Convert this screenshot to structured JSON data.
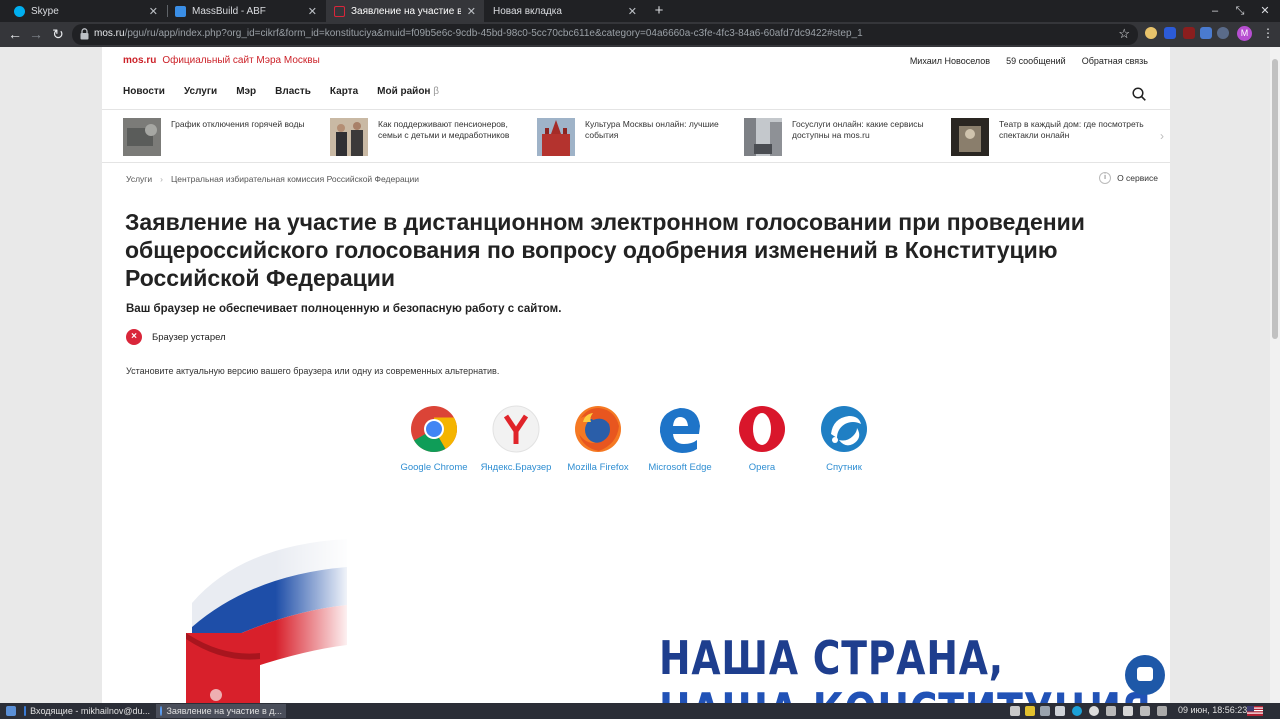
{
  "browser": {
    "tabs": [
      {
        "title": "Skype",
        "color": "#00aff0"
      },
      {
        "title": "MassBuild - ABF",
        "color": "#3a8ee6"
      },
      {
        "title": "Заявление на участие в дист",
        "color": "#d9263a"
      },
      {
        "title": "Новая вкладка",
        "color": ""
      }
    ],
    "url_domain": "mos.ru",
    "url_path": "/pgu/ru/app/index.php?org_id=cikrf&form_id=konstituciya&muid=f09b5e6c-9cdb-45bd-98c0-5cc70cbc611e&category=04a6660a-c3fe-4fc3-84a6-60afd7dc9422#step_1",
    "profile_initial": "M"
  },
  "site": {
    "brand": "mos.ru",
    "brand_sub": "Официальный сайт Мэра Москвы",
    "user_links": [
      "Михаил Новоселов",
      "59 сообщений",
      "Обратная связь"
    ],
    "nav": [
      "Новости",
      "Услуги",
      "Мэр",
      "Власть",
      "Карта",
      "Мой район"
    ],
    "nav_beta": "β",
    "news": [
      {
        "text": "График отключения горячей воды"
      },
      {
        "text": "Как поддерживают пенсионеров, семьи с детьми и медработников"
      },
      {
        "text": "Культура Москвы онлайн: лучшие события"
      },
      {
        "text": "Госуслуги онлайн: какие сервисы доступны на mos.ru"
      },
      {
        "text": "Театр в каждый дом: где посмотреть спектакли онлайн"
      }
    ],
    "news_arrow": "›",
    "breadcrumb": [
      "Услуги",
      "Центральная избирательная комиссия Российской Федерации"
    ],
    "breadcrumb_sep": "›",
    "about_service": "О сервисе",
    "about_icon": "i"
  },
  "content": {
    "title": "Заявление на участие в дистанционном электронном голосовании при проведении общероссийского голосования по вопросу одобрения изменений в Конституцию Российской Федерации",
    "warning": "Ваш браузер не обеспечивает полноценную и безопасную работу с сайтом.",
    "status": "Браузер устарел",
    "status_mark": "×",
    "hint": "Установите актуальную версию вашего браузера или одну из современных альтернатив.",
    "browsers": [
      "Google Chrome",
      "Яндекс.Браузер",
      "Mozilla Firefox",
      "Microsoft Edge",
      "Opera",
      "Спутник"
    ],
    "banner_line1": "НАША СТРАНА,",
    "banner_line2": "НАША КОНСТИТУЦИЯ"
  },
  "taskbar": {
    "tasks": [
      "Входящие - mikhailnov@du...",
      "Заявление на участие в д..."
    ],
    "clock": "09 июн, 18:56:23"
  },
  "colors": {
    "brand_red": "#cc2229",
    "link_blue": "#2f8ed2",
    "banner_blue": "#1e3e8e",
    "error_red": "#d9263a"
  }
}
